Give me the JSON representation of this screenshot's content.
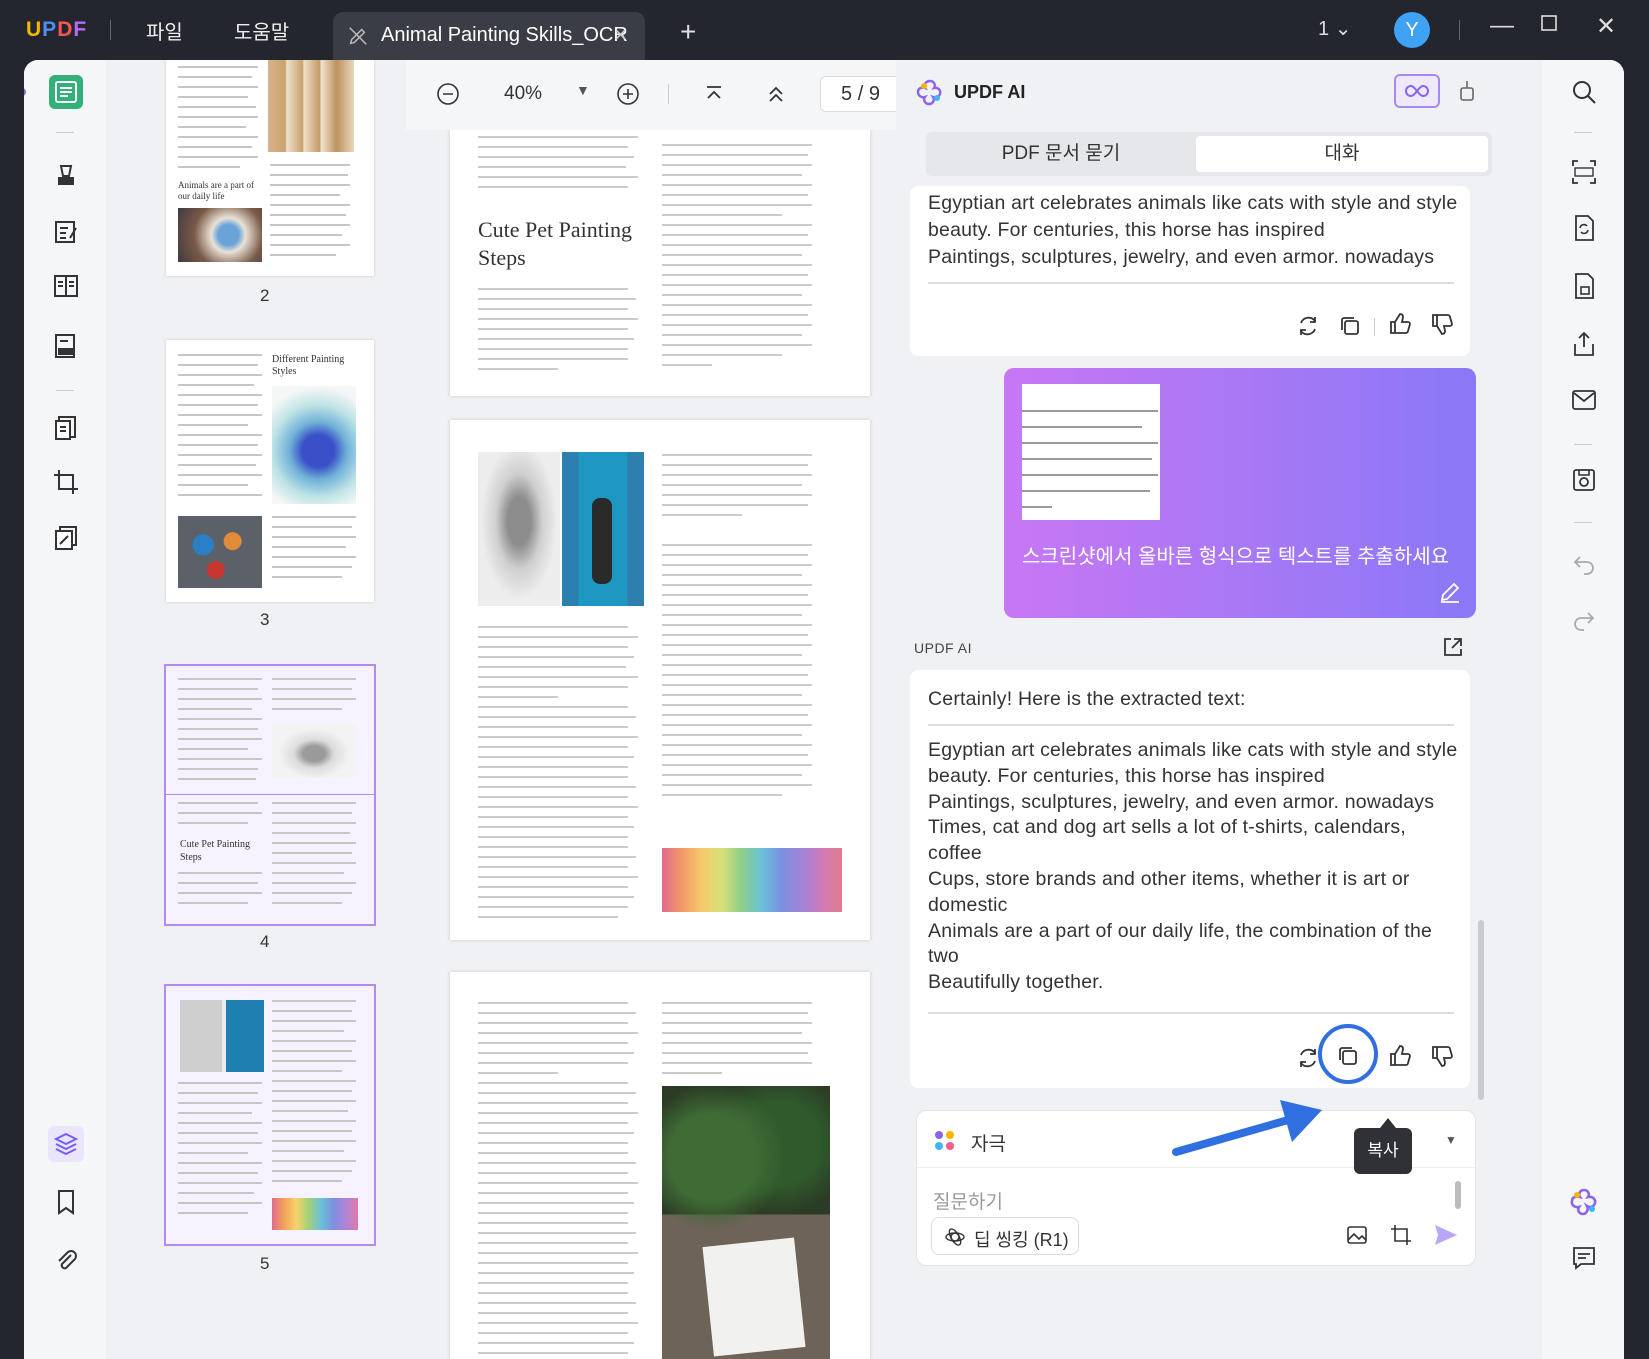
{
  "app": {
    "logo": "UPDF",
    "menu": [
      "파일",
      "도움말"
    ],
    "tab_title": "Animal Painting Skills_OCR",
    "page_selector": "1",
    "user_initial": "Y"
  },
  "toolbar": {
    "zoom": "40%",
    "page_current": "5",
    "page_separator": "/",
    "page_total": "9"
  },
  "thumbnails": [
    {
      "number": "2",
      "caption": "Animals are a part of our daily life"
    },
    {
      "number": "3",
      "caption": "Different Painting Styles"
    },
    {
      "number": "4",
      "caption": "Cute Pet Painting Steps"
    },
    {
      "number": "5",
      "caption": ""
    }
  ],
  "viewer": {
    "page_title": "Cute Pet Painting Steps"
  },
  "ai": {
    "title": "UPDF AI",
    "mode_tabs": [
      "PDF 문서 묻기",
      "대화"
    ],
    "first_response": [
      "Egyptian art celebrates animals like cats with style and style",
      "beauty. For centuries, this horse has inspired",
      "Paintings, sculptures, jewelry, and even armor. nowadays"
    ],
    "user_prompt": "스크린샷에서 올바른 형식으로 텍스트를 추출하세요",
    "assistant_label": "UPDF AI",
    "answer_intro": "Certainly! Here is the extracted text:",
    "answer_lines": [
      "Egyptian art celebrates animals like cats with style and style",
      "beauty. For centuries, this horse has inspired",
      "Paintings, sculptures, jewelry, and even armor. nowadays",
      "Times, cat and dog art sells a lot of t-shirts, calendars,",
      "coffee",
      "Cups, store brands and other items, whether it is art or",
      "domestic",
      "Animals are a part of our daily life, the combination of the",
      "two",
      "Beautifully together."
    ],
    "tooltip": "복사",
    "prompt_type": "자극",
    "input_placeholder": "질문하기",
    "deep_thinking": "딥 씽킹 (R1)"
  },
  "colors": {
    "accent": "#8a63f0",
    "arrow": "#2f6fe0",
    "bubble_start": "#c877f4",
    "bubble_end": "#8a78f6"
  }
}
